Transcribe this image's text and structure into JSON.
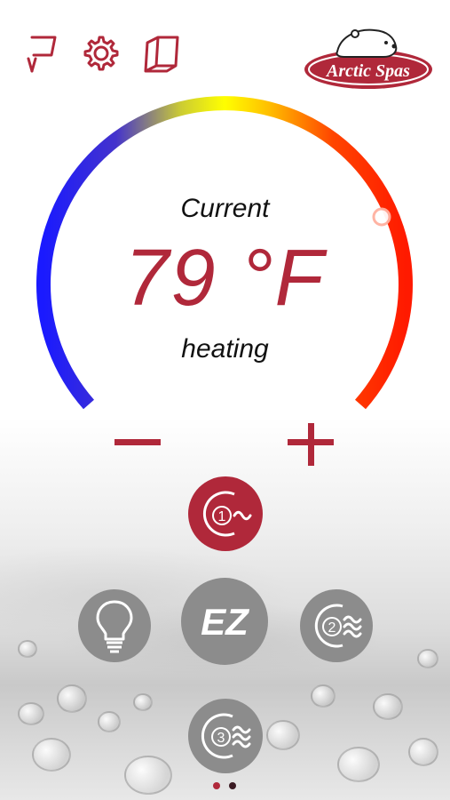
{
  "header": {
    "help_icon": "help-p-icon",
    "settings_icon": "gear-icon",
    "manual_icon": "book-icon",
    "logo_text": "Arctic Spas"
  },
  "dial": {
    "label": "Current",
    "temperature": "79 °F",
    "status": "heating"
  },
  "controls": {
    "minus_icon": "minus-icon",
    "plus_icon": "plus-icon",
    "pump1_label": "1",
    "pump2_label": "2",
    "pump3_label": "3",
    "ez_label": "EZ",
    "light_icon": "lightbulb-icon"
  },
  "pager": {
    "pages": 2,
    "active": 1
  },
  "colors": {
    "brand": "#b0283a",
    "button_gray": "#8c8c8c",
    "active_dot": "#b0283a",
    "inactive_dot": "#3a1a22"
  }
}
